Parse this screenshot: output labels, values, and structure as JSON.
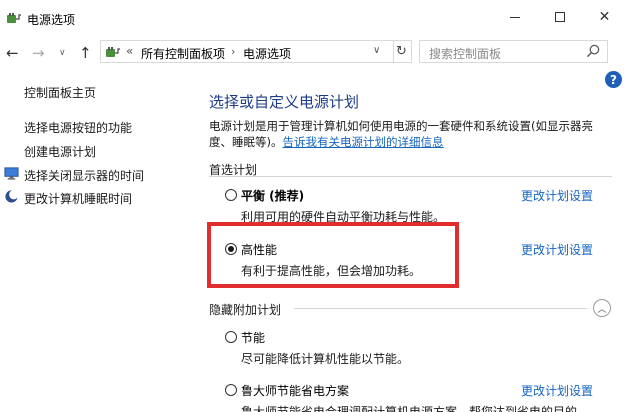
{
  "window": {
    "title": "电源选项",
    "min_icon": "minimize-icon",
    "max_icon": "maximize-icon",
    "close_symbol": "✕"
  },
  "address": {
    "chevrons": "«",
    "crumbs": [
      "所有控制面板项",
      "电源选项"
    ],
    "separator": "›",
    "dropdown": "∨",
    "search_placeholder": "搜索控制面板"
  },
  "sidebar": {
    "home": "控制面板主页",
    "links": [
      {
        "label": "选择电源按钮的功能",
        "icon": ""
      },
      {
        "label": "创建电源计划",
        "icon": ""
      },
      {
        "label": "选择关闭显示器的时间",
        "icon": "monitor-icon"
      },
      {
        "label": "更改计算机睡眠时间",
        "icon": "moon-icon"
      }
    ]
  },
  "main": {
    "title": "选择或自定义电源计划",
    "intro": "电源计划是用于管理计算机如何使用电源的一套硬件和系统设置(如显示器亮度、睡眠等)。",
    "intro_link": "告诉我有关电源计划的详细信息",
    "preferred_label": "首选计划",
    "hidden_label": "隐藏附加计划",
    "plans": [
      {
        "name": "平衡 (推荐)",
        "desc": "利用可用的硬件自动平衡功耗与性能。",
        "link": "更改计划设置",
        "selected": false
      },
      {
        "name": "高性能",
        "desc": "有利于提高性能，但会增加功耗。",
        "link": "更改计划设置",
        "selected": true
      },
      {
        "name": "节能",
        "desc": "尽可能降低计算机性能以节能。",
        "link": "",
        "selected": false
      },
      {
        "name": "鲁大师节能省电方案",
        "desc": "鲁大师节能省电合理调配计算机电源方案，帮您达到省电的目的。",
        "link": "更改计划设置",
        "selected": false
      }
    ]
  },
  "colors": {
    "highlight": "#e12d2d",
    "link": "#1565c0",
    "title": "#1e3c87"
  }
}
